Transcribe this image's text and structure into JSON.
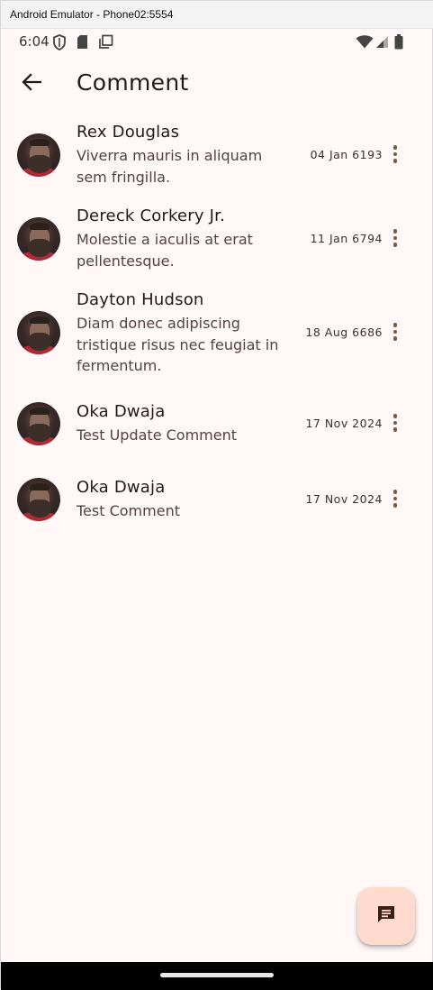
{
  "window": {
    "title": "Android Emulator - Phone02:5554"
  },
  "status_bar": {
    "time": "6:04",
    "icons": [
      "shield-icon",
      "sd-card-icon",
      "copy-icon",
      "wifi-icon",
      "signal-icon",
      "battery-icon"
    ]
  },
  "app_bar": {
    "title": "Comment",
    "back_icon": "arrow-back-icon"
  },
  "comments": [
    {
      "name": "Rex Douglas",
      "text": "Viverra mauris in aliquam sem fringilla.",
      "date": "04 Jan 6193"
    },
    {
      "name": "Dereck Corkery Jr.",
      "text": "Molestie a iaculis at erat pellentesque.",
      "date": "11 Jan 6794"
    },
    {
      "name": "Dayton Hudson",
      "text": "Diam donec adipiscing tristique risus nec feugiat in fermentum.",
      "date": "18 Aug 6686"
    },
    {
      "name": "Oka Dwaja",
      "text": "Test Update Comment",
      "date": "17 Nov 2024"
    },
    {
      "name": "Oka Dwaja",
      "text": "Test Comment",
      "date": "17 Nov 2024"
    }
  ],
  "fab": {
    "icon": "comment-icon"
  },
  "colors": {
    "background": "#fff8f6",
    "fab": "#ffdbcf",
    "more_dots": "#7a5a40",
    "text_primary": "#201a19",
    "text_secondary": "#534340"
  }
}
